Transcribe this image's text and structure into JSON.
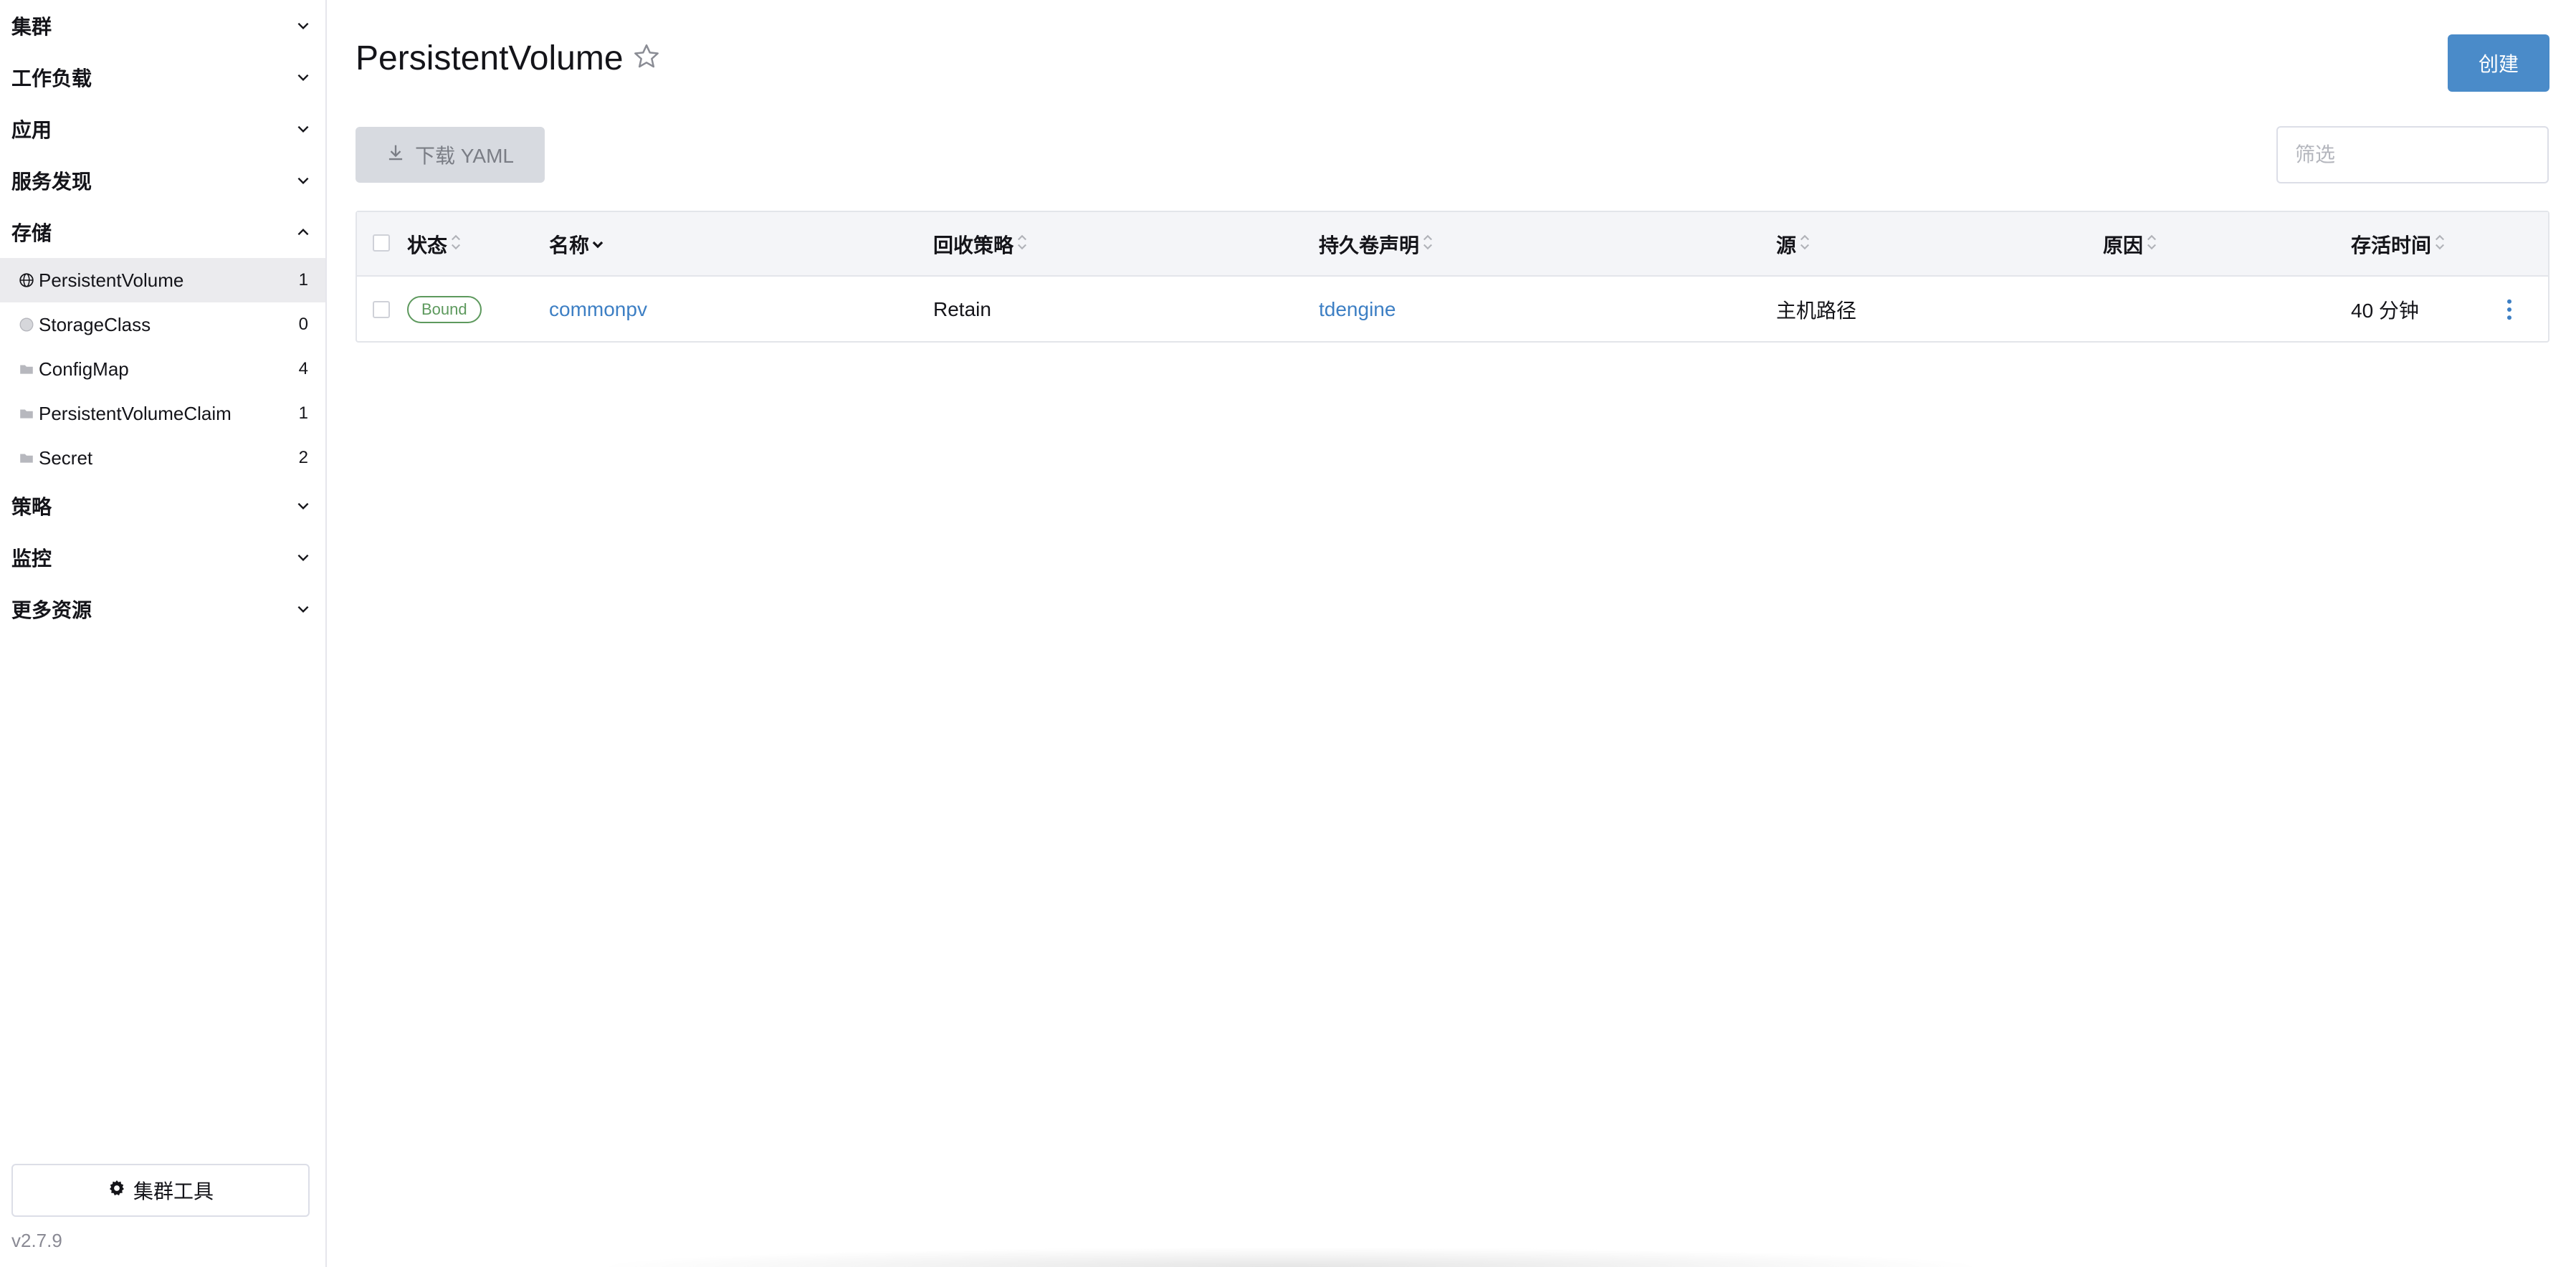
{
  "sidebar": {
    "groups_top": [
      {
        "label": "集群",
        "expanded": false
      },
      {
        "label": "工作负载",
        "expanded": false
      },
      {
        "label": "应用",
        "expanded": false
      },
      {
        "label": "服务发现",
        "expanded": false
      },
      {
        "label": "存储",
        "expanded": true
      }
    ],
    "items": [
      {
        "label": "PersistentVolume",
        "count": "1",
        "icon": "globe-icon",
        "active": true
      },
      {
        "label": "StorageClass",
        "count": "0",
        "icon": "globe-icon",
        "active": false
      },
      {
        "label": "ConfigMap",
        "count": "4",
        "icon": "folder-icon",
        "active": false
      },
      {
        "label": "PersistentVolumeClaim",
        "count": "1",
        "icon": "folder-icon",
        "active": false
      },
      {
        "label": "Secret",
        "count": "2",
        "icon": "folder-icon",
        "active": false
      }
    ],
    "groups_bottom": [
      {
        "label": "策略",
        "expanded": false
      },
      {
        "label": "监控",
        "expanded": false
      },
      {
        "label": "更多资源",
        "expanded": false
      }
    ],
    "cluster_tools_label": "集群工具",
    "version": "v2.7.9"
  },
  "header": {
    "title": "PersistentVolume",
    "create_label": "创建"
  },
  "toolbar": {
    "download_yaml_label": "下载 YAML",
    "filter_placeholder": "筛选"
  },
  "table": {
    "columns": [
      "状态",
      "名称",
      "回收策略",
      "持久卷声明",
      "源",
      "原因",
      "存活时间"
    ],
    "rows": [
      {
        "status": "Bound",
        "name": "commonpv",
        "reclaim_policy": "Retain",
        "claim": "tdengine",
        "source": "主机路径",
        "reason": "",
        "age": "40 分钟"
      }
    ]
  },
  "colors": {
    "accent": "#4a8bc9",
    "link": "#3d7fc4",
    "bound_badge": "#5d995d",
    "active_item_bg": "#ebebee"
  }
}
